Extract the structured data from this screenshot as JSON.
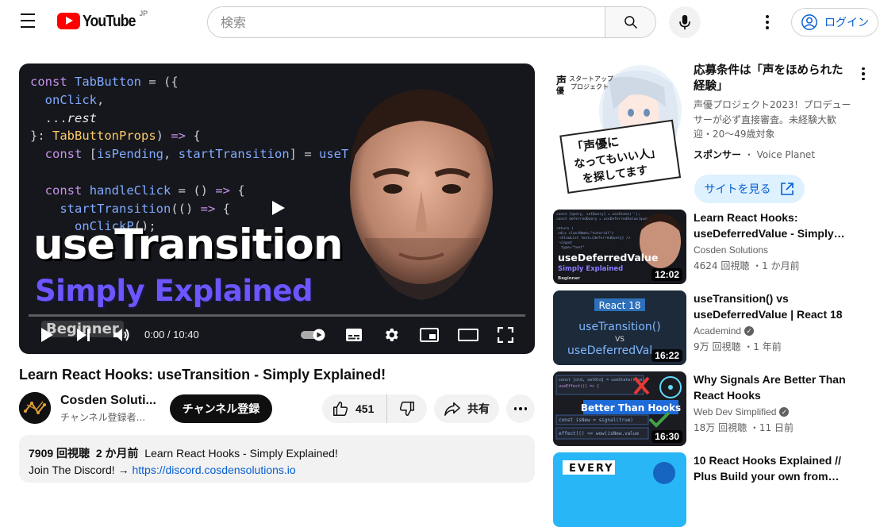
{
  "header": {
    "logo_text": "YouTube",
    "region": "JP",
    "search_placeholder": "検索",
    "login_label": "ログイン"
  },
  "player": {
    "code_lines": [
      "const TabButton = ({",
      "  onClick,",
      "  ...rest",
      "}: TabButtonProps) => {",
      "  const [isPending, startTransition] = useT",
      "",
      "  const handleClick = () => {",
      "    startTransition(() => {",
      "      onClickP();"
    ],
    "thumb_title": "useTransition",
    "thumb_subtitle": "Simply Explained",
    "thumb_badge": "Beginner",
    "time": "0:00 / 10:40",
    "progress": 0.0
  },
  "video": {
    "title": "Learn React Hooks: useTransition - Simply Explained!",
    "channel": "Cosden Soluti...",
    "subscribers": "チャンネル登録者...",
    "subscribe_label": "チャンネル登録",
    "likes": "451",
    "share_label": "共有",
    "description": {
      "views": "7909 回視聴",
      "date": "2 か月前",
      "title": "Learn React Hooks - Simply Explained!",
      "line2_prefix": "Join The Discord! → ",
      "link": "https://discord.cosdensolutions.io"
    }
  },
  "ad": {
    "title": "応募条件は「声をほめられた経験」",
    "desc": "声優プロジェクト2023！プロデューサーが必ず直接審査。未経験大歓迎・20〜49歳対象",
    "sponsor_label": "スポンサー",
    "sponsor_name": "Voice Planet",
    "cta_label": "サイトを見る",
    "thumb_text_lines": [
      "「声優に",
      "なってもいい人」",
      "を探してます"
    ],
    "thumb_logo_line1": "スタートアップ",
    "thumb_logo_line2": "プロジェクト",
    "thumb_logo_kanji": "声優"
  },
  "recommendations": [
    {
      "title": "Learn React Hooks: useDeferredValue - Simply…",
      "channel": "Cosden Solutions",
      "verified": false,
      "meta": "4624 回視聴 ・1 か月前",
      "duration": "12:02",
      "thumb_main": "useDeferredValue",
      "thumb_sub": "Simply Explained",
      "thumb_badge": "Beginner"
    },
    {
      "title": "useTransition() vs useDeferredValue | React 18",
      "channel": "Academind",
      "verified": true,
      "meta": "9万 回視聴 ・1 年前",
      "duration": "16:22",
      "thumb_badge": "React 18",
      "thumb_line1": "useTransition()",
      "thumb_vs": "VS",
      "thumb_line2": "useDeferredVal"
    },
    {
      "title": "Why Signals Are Better Than React Hooks",
      "channel": "Web Dev Simplified",
      "verified": true,
      "meta": "18万 回視聴 ・11 日前",
      "duration": "16:30",
      "thumb_main": "Better Than Hooks",
      "thumb_code1": "const [old, setOld] = useState(true)",
      "thumb_code2": "const isNew = signal(true)",
      "thumb_code3": "effect(() => wow(isNew.value"
    },
    {
      "title": "10 React Hooks Explained // Plus Build your own from…",
      "channel": "",
      "verified": false,
      "meta": "",
      "duration": "",
      "thumb_main": "EVERY"
    }
  ]
}
